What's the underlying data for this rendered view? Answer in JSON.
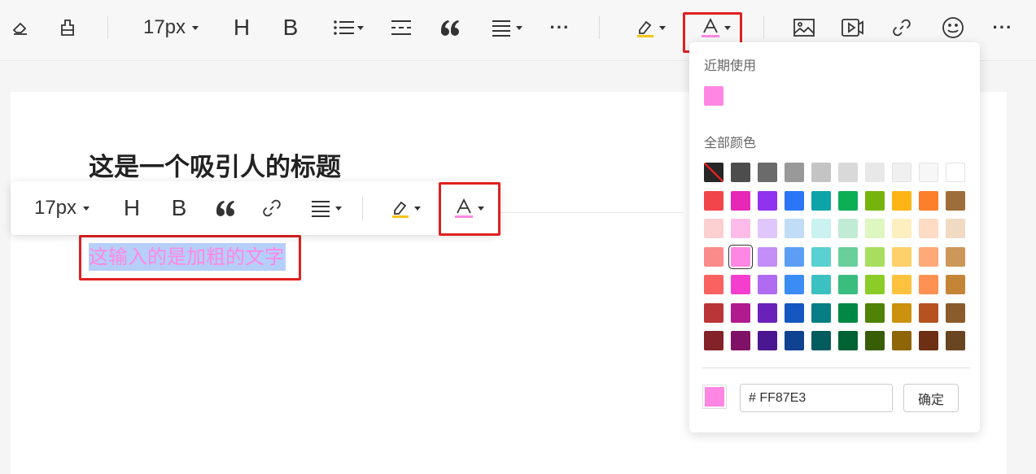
{
  "toolbar": {
    "font_size": "17px",
    "heading_label": "H",
    "bold_label": "B",
    "more_label": "···"
  },
  "document": {
    "heading": "这是一个吸引人的标题",
    "selected_text": "这输入的是加粗的文字"
  },
  "floating_toolbar": {
    "font_size": "17px",
    "heading_label": "H",
    "bold_label": "B"
  },
  "color_picker": {
    "recent_label": "近期使用",
    "all_label": "全部颜色",
    "recent_colors": [
      "#FF87E3"
    ],
    "palette": [
      [
        "#262626",
        "#4d4d4d",
        "#6b6b6b",
        "#999999",
        "#c4c4c4",
        "#d9d9d9",
        "#e8e8e8",
        "#f0f0f0",
        "#f7f7f7",
        "#ffffff"
      ],
      [
        "#f2444b",
        "#e528b5",
        "#8f33ee",
        "#2b75f7",
        "#0ca4a9",
        "#0eae57",
        "#75b40d",
        "#fdb515",
        "#fd7f2c",
        "#9d6e3a"
      ],
      [
        "#fccfd0",
        "#fcbbe9",
        "#e0c7fb",
        "#c1dcf6",
        "#c9f2f0",
        "#c1ebd5",
        "#def6c0",
        "#feefc0",
        "#fedbc4",
        "#f1dac2"
      ],
      [
        "#fb8a8a",
        "#ff87e3",
        "#c38ef7",
        "#5c9ef6",
        "#5bd0d0",
        "#6bcf9b",
        "#a8de5d",
        "#fed06a",
        "#ffa978",
        "#cc9759"
      ],
      [
        "#fa6161",
        "#f43fce",
        "#b06bf2",
        "#3c8cf6",
        "#3cc1c1",
        "#3bbd7d",
        "#8bcc29",
        "#ffc23f",
        "#ff9152",
        "#c48537"
      ],
      [
        "#b93537",
        "#b11b8e",
        "#6a21b9",
        "#1557c1",
        "#077e83",
        "#028845",
        "#4f8205",
        "#cc920d",
        "#b55220",
        "#8a5c2b"
      ],
      [
        "#832228",
        "#7f1166",
        "#4b1791",
        "#0f4290",
        "#055c5f",
        "#016234",
        "#375d06",
        "#8e6507",
        "#6d3014",
        "#6a4521"
      ]
    ],
    "selected_color": "#ff87e3",
    "hex_value": "# FF87E3",
    "confirm_label": "确定"
  },
  "colors": {
    "highlight_red": "#e02020",
    "text_color": "#ff87e3",
    "selection_bg": "#b6cff8",
    "highlighter_yellow": "#f5c518"
  }
}
